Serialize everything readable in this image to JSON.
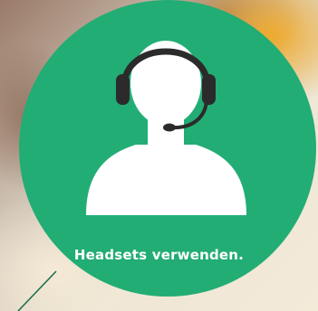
{
  "caption": "Headsets verwenden.",
  "colors": {
    "circle": "#22ad75",
    "figure": "#ffffff",
    "headset": "#2b2b2b",
    "pointer": "#1f6f4d"
  },
  "icons": [
    "headset-person-icon"
  ]
}
